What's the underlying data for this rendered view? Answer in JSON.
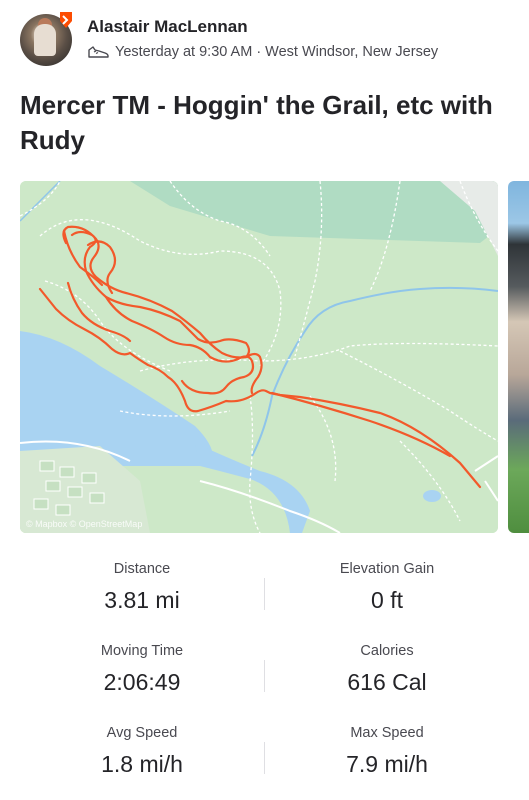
{
  "activity": {
    "athlete_name": "Alastair MacLennan",
    "sport_icon": "shoe-icon",
    "time": "Yesterday at 9:30 AM",
    "separator": "·",
    "location": "West Windsor, New Jersey",
    "title": "Mercer TM - Hoggin' the Grail, etc with Rudy"
  },
  "map": {
    "attribution": "© Mapbox © OpenStreetMap",
    "route_color": "#f2592b",
    "park_color": "#cde8c8",
    "water_color": "#a9d3f2"
  },
  "stats": [
    {
      "label": "Distance",
      "value": "3.81 mi"
    },
    {
      "label": "Elevation Gain",
      "value": "0 ft"
    },
    {
      "label": "Moving Time",
      "value": "2:06:49"
    },
    {
      "label": "Calories",
      "value": "616 Cal"
    },
    {
      "label": "Avg Speed",
      "value": "1.8 mi/h"
    },
    {
      "label": "Max Speed",
      "value": "7.9 mi/h"
    }
  ]
}
